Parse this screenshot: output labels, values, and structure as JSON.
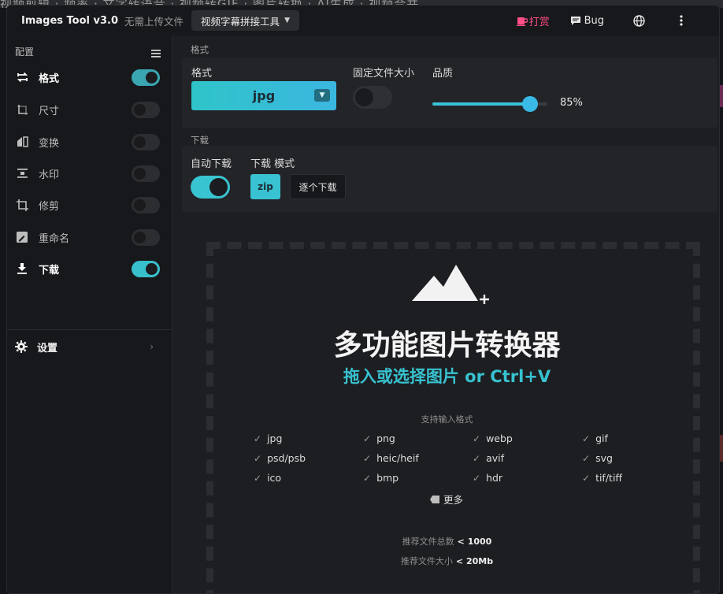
{
  "app": {
    "title": "Images Tool v3.0",
    "subtitle": "无需上传文件",
    "tool_selector": "视频字幕拼接工具",
    "donate_label": "打赏",
    "bug_label": "Bug"
  },
  "background": {
    "strip_text": "视频剪辑  ·  频率  ·  文字转语音  ·  视频转GIF  ·  图片转换  ·  AI生成  ·  视频合并"
  },
  "sidebar": {
    "header": "配置",
    "items": [
      {
        "label": "格式",
        "icon": "swap-icon",
        "enabled": true
      },
      {
        "label": "尺寸",
        "icon": "resize-icon",
        "enabled": false
      },
      {
        "label": "变换",
        "icon": "transform-icon",
        "enabled": false
      },
      {
        "label": "水印",
        "icon": "watermark-icon",
        "enabled": false
      },
      {
        "label": "修剪",
        "icon": "crop-icon",
        "enabled": false
      },
      {
        "label": "重命名",
        "icon": "rename-icon",
        "enabled": false
      },
      {
        "label": "下载",
        "icon": "download-icon",
        "enabled": true
      }
    ],
    "settings_label": "设置"
  },
  "format_section": {
    "title": "格式",
    "format_label": "格式",
    "format_value": "jpg",
    "fixed_size_label": "固定文件大小",
    "fixed_size_enabled": false,
    "quality_label": "品质",
    "quality_value": 85,
    "quality_text": "85%"
  },
  "download_section": {
    "title": "下载",
    "auto_label": "自动下载",
    "auto_enabled": true,
    "mode_label": "下载 模式",
    "mode_zip": "zip",
    "mode_single": "逐个下载"
  },
  "dropzone": {
    "headline": "多功能图片转换器",
    "subline": "拖入或选择图片 or Ctrl+V",
    "formats_header": "支持输入格式",
    "formats": [
      "jpg",
      "png",
      "webp",
      "gif",
      "psd/psb",
      "heic/heif",
      "avif",
      "svg",
      "ico",
      "bmp",
      "hdr",
      "tif/tiff"
    ],
    "more_label": "更多",
    "rec_count_label": "推荐文件总数",
    "rec_count_value": "< 1000",
    "rec_size_label": "推荐文件大小",
    "rec_size_value": "< 20Mb"
  },
  "colors": {
    "accent": "#38c4d0",
    "donate": "#ff4f86",
    "window_bg": "#1d1e21",
    "panel_bg": "#232428"
  }
}
